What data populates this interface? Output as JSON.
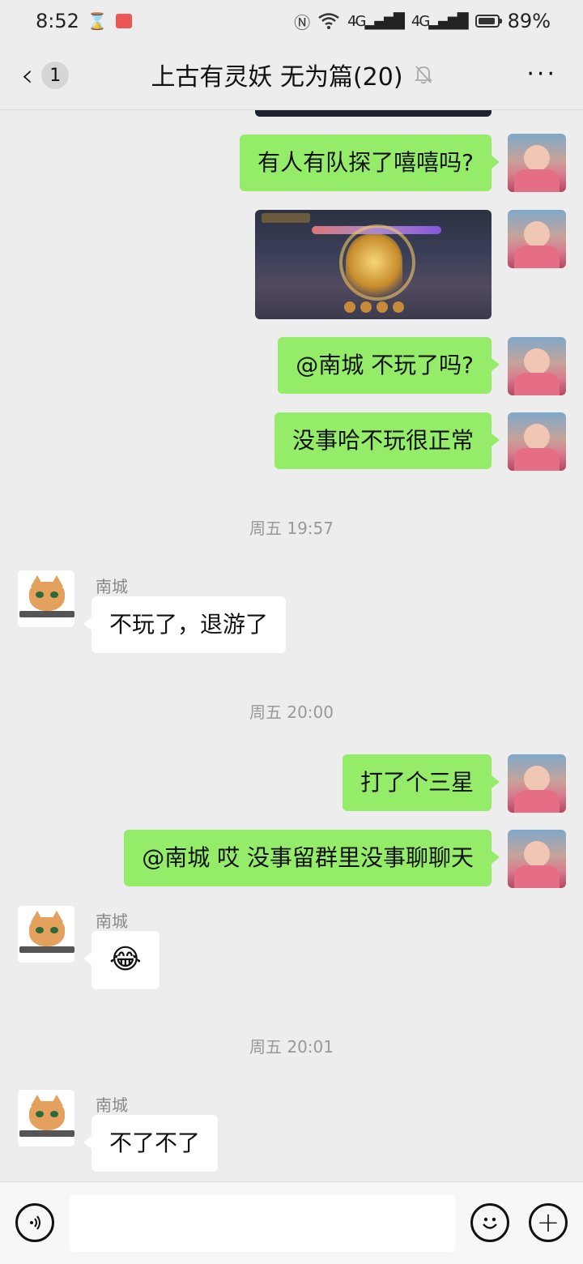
{
  "status_bar": {
    "time": "8:52",
    "network_1": "4G",
    "network_2": "4G",
    "battery_level": 0.89,
    "battery_text": "89%",
    "icons": [
      "hourglass-icon",
      "app-icon",
      "nfc-icon",
      "wifi-icon",
      "signal-icon",
      "battery-icon"
    ]
  },
  "header": {
    "back_icon": "chevron-left-icon",
    "unread_count": "1",
    "title": "上古有灵妖 无为篇(20)",
    "mute_icon": "bell-off-icon",
    "more_label": "···"
  },
  "colors": {
    "background": "#ededed",
    "my_bubble": "#95ec69",
    "their_bubble": "#ffffff",
    "time_text": "#999999"
  },
  "messages": [
    {
      "type": "image",
      "from": "me",
      "alt": "game-screenshot-partial"
    },
    {
      "type": "text",
      "from": "me",
      "text": "有人有队探了嘻嘻吗?"
    },
    {
      "type": "image",
      "from": "me",
      "alt": "game-screenshot"
    },
    {
      "type": "text",
      "from": "me",
      "text": "@南城  不玩了吗?"
    },
    {
      "type": "text",
      "from": "me",
      "text": "没事哈不玩很正常"
    },
    {
      "type": "time",
      "text": "周五 19:57"
    },
    {
      "type": "text",
      "from": "them",
      "sender": "南城",
      "text": "不玩了，退游了"
    },
    {
      "type": "time",
      "text": "周五 20:00"
    },
    {
      "type": "text",
      "from": "me",
      "text": "打了个三星"
    },
    {
      "type": "text",
      "from": "me",
      "text": "@南城  哎 没事留群里没事聊聊天"
    },
    {
      "type": "emoji",
      "from": "them",
      "sender": "南城",
      "text": "😂"
    },
    {
      "type": "time",
      "text": "周五 20:01"
    },
    {
      "type": "text",
      "from": "them",
      "sender": "南城",
      "text": "不了不了"
    }
  ],
  "input_bar": {
    "voice_icon": "voice-icon",
    "input_value": "",
    "emoji_icon": "smile-icon",
    "plus_icon": "plus-icon",
    "plus_label": "+"
  }
}
